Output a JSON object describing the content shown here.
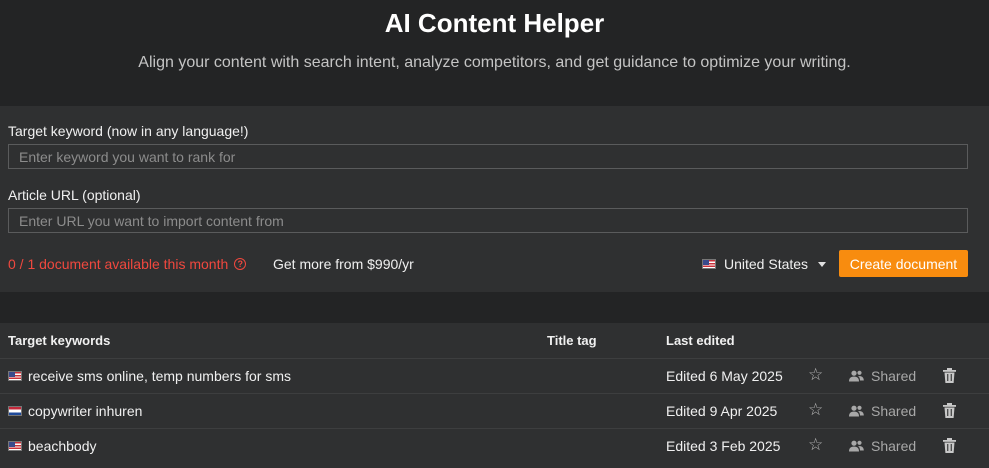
{
  "header": {
    "title": "AI Content Helper",
    "subtitle": "Align your content with search intent, analyze competitors, and get guidance to optimize your writing."
  },
  "form": {
    "keyword_label": "Target keyword (now in any language!)",
    "keyword_placeholder": "Enter keyword you want to rank for",
    "keyword_value": "",
    "url_label": "Article URL (optional)",
    "url_placeholder": "Enter URL you want to import content from",
    "url_value": "",
    "quota_text": "0 / 1 document available this month",
    "upsell_text": "Get more from $990/yr",
    "country": "United States",
    "country_flag": "us-flag-icon",
    "create_label": "Create document"
  },
  "colors": {
    "accent": "#f88c0f",
    "warning": "#f0483e",
    "panel": "#2f3031",
    "background": "#232425"
  },
  "table": {
    "columns": [
      "Target keywords",
      "Title tag",
      "Last edited"
    ],
    "rows": [
      {
        "keyword": "receive sms online, temp numbers for sms",
        "flag": "us-flag-icon",
        "title_tag": "",
        "last_edited": "Edited 6 May 2025",
        "share": "Shared"
      },
      {
        "keyword": "copywriter inhuren",
        "flag": "nl-flag-icon",
        "title_tag": "",
        "last_edited": "Edited 9 Apr 2025",
        "share": "Shared"
      },
      {
        "keyword": "beachbody",
        "flag": "us-flag-icon",
        "title_tag": "",
        "last_edited": "Edited 3 Feb 2025",
        "share": "Shared"
      }
    ]
  }
}
